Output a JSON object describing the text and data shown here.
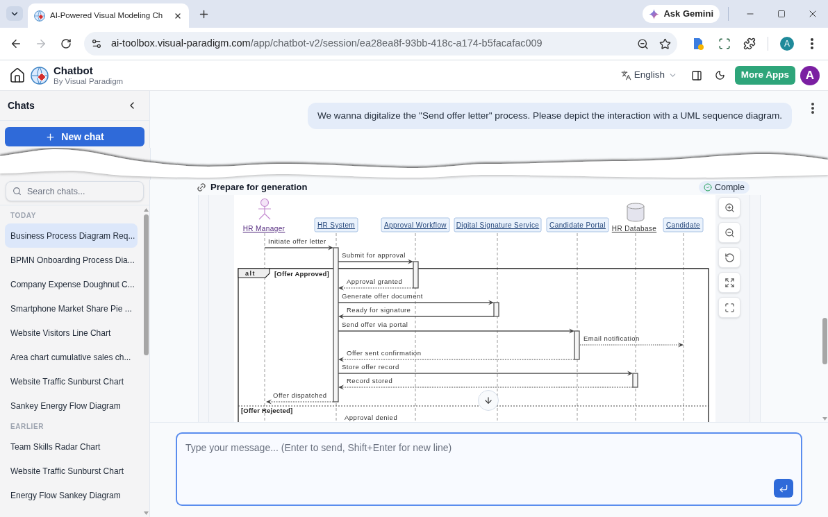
{
  "browser": {
    "tabs": [
      {
        "title": "AI-Powered Visual Modeling Ch",
        "selected": true
      }
    ],
    "gemini_button": "Ask Gemini",
    "forward_disabled": true,
    "url": {
      "host": "ai-toolbox.visual-paradigm.com",
      "path": "/app/chatbot-v2/session/ea28ea8f-93bb-418c-a174-b5facafac009"
    },
    "profile_initial": "A"
  },
  "app_bar": {
    "title": "Chatbot",
    "subtitle": "By Visual Paradigm",
    "language": "English",
    "more_apps": "More Apps",
    "avatar_initial": "A"
  },
  "sidebar": {
    "title": "Chats",
    "new_chat": "New chat",
    "search": {
      "placeholder": "Search chats..."
    },
    "groups": [
      {
        "heading": "TODAY",
        "items": [
          {
            "title": "Business Process Diagram Req...",
            "selected": true
          },
          {
            "title": "BPMN Onboarding Process Dia...",
            "selected": false
          },
          {
            "title": "Company Expense Doughnut C...",
            "selected": false
          },
          {
            "title": "Smartphone Market Share Pie ...",
            "selected": false
          },
          {
            "title": "Website Visitors Line Chart",
            "selected": false
          },
          {
            "title": "Area chart cumulative sales ch...",
            "selected": false
          },
          {
            "title": "Website Traffic Sunburst Chart",
            "selected": false
          },
          {
            "title": "Sankey Energy Flow Diagram",
            "selected": false
          }
        ]
      },
      {
        "heading": "EARLIER",
        "items": [
          {
            "title": "Team Skills Radar Chart",
            "selected": false
          },
          {
            "title": "Website Traffic Sunburst Chart",
            "selected": false
          },
          {
            "title": "Energy Flow Sankey Diagram",
            "selected": false
          }
        ]
      }
    ]
  },
  "conversation": {
    "messages": [
      {
        "text": "We wanna digitalize the \"Send offer letter\" process. Please depict the interaction with a UML sequence diagram."
      }
    ],
    "step": {
      "label": "Prepare for generation",
      "status": "Comple"
    },
    "diagram": {
      "participants": [
        {
          "name": "HR Manager",
          "kind": "actor"
        },
        {
          "name": "HR System",
          "kind": "box"
        },
        {
          "name": "Approval Workflow",
          "kind": "box"
        },
        {
          "name": "Digital Signature Service",
          "kind": "box"
        },
        {
          "name": "Candidate Portal",
          "kind": "box"
        },
        {
          "name": "HR Database",
          "kind": "database"
        },
        {
          "name": "Candidate",
          "kind": "box"
        }
      ],
      "fragment": {
        "operator": "alt",
        "guards": [
          "[Offer Approved]",
          "[Offer Rejected]"
        ]
      },
      "messages": [
        {
          "label": "Initiate offer letter",
          "kind": "call"
        },
        {
          "label": "Submit for approval",
          "kind": "call"
        },
        {
          "label": "Approval granted",
          "kind": "reply"
        },
        {
          "label": "Generate offer document",
          "kind": "call"
        },
        {
          "label": "Ready for signature",
          "kind": "call"
        },
        {
          "label": "Send offer via portal",
          "kind": "call"
        },
        {
          "label": "Email notification",
          "kind": "async"
        },
        {
          "label": "Offer sent confirmation",
          "kind": "reply"
        },
        {
          "label": "Store offer record",
          "kind": "call"
        },
        {
          "label": "Record stored",
          "kind": "reply"
        },
        {
          "label": "Offer dispatched",
          "kind": "reply"
        },
        {
          "label": "Approval denied"
        }
      ]
    }
  },
  "composer": {
    "placeholder": "Type your message... (Enter to send, Shift+Enter for new line)"
  }
}
